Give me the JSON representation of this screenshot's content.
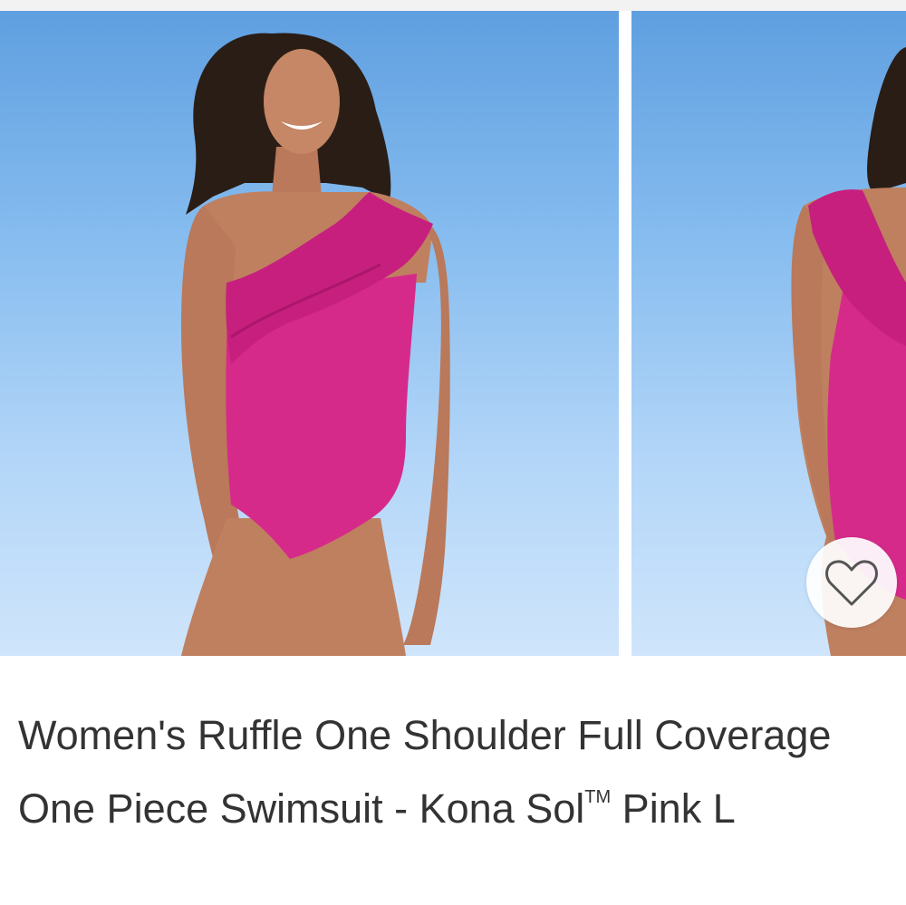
{
  "product": {
    "title_main": "Women's Ruffle One Shoulder Full Coverage One Piece Swimsuit - Kona Sol",
    "title_tm": "TM",
    "title_variant": " Pink L"
  },
  "gallery": {
    "images": [
      {
        "alt": "model front"
      },
      {
        "alt": "model back"
      }
    ],
    "favorite_icon": "heart-outline-icon"
  },
  "colors": {
    "swimsuit": "#d62a8a",
    "sky_top": "#5f9fe0",
    "sky_bottom": "#cfe5fb",
    "text": "#333333"
  }
}
